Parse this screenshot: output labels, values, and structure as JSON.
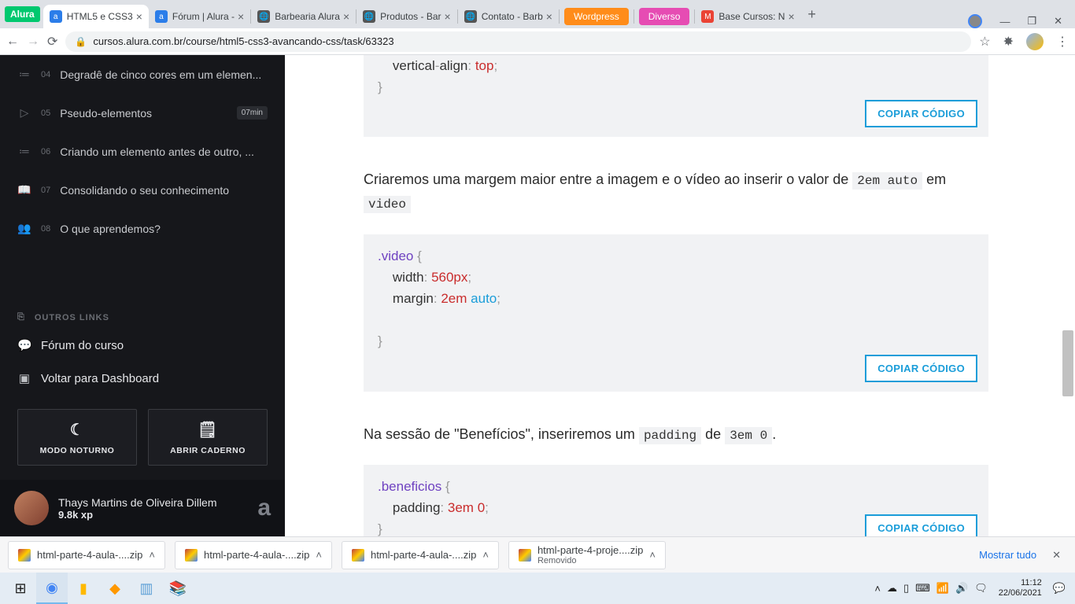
{
  "browser": {
    "product_badge": "Alura",
    "tabs": [
      {
        "title": "HTML5 e CSS3",
        "fav_bg": "#2b7de9",
        "fav_txt": "a",
        "active": true
      },
      {
        "title": "Fórum | Alura -",
        "fav_bg": "#2b7de9",
        "fav_txt": "a"
      },
      {
        "title": "Barbearia Alura",
        "fav_bg": "#555",
        "fav_txt": "🌐"
      },
      {
        "title": "Produtos - Bar",
        "fav_bg": "#555",
        "fav_txt": "🌐"
      },
      {
        "title": "Contato - Barb",
        "fav_bg": "#555",
        "fav_txt": "🌐"
      },
      {
        "title": "Wordpress",
        "fav_bg": "#ff8c1a",
        "fav_txt": "",
        "badge": true
      },
      {
        "title": "Diverso",
        "fav_bg": "#e64cb3",
        "fav_txt": "",
        "badge": true
      },
      {
        "title": "Base Cursos: N",
        "fav_bg": "#ea4335",
        "fav_txt": "M"
      }
    ],
    "url": "cursos.alura.com.br/course/html5-css3-avancando-css/task/63323"
  },
  "sidebar": {
    "items": [
      {
        "num": "04",
        "label": "Degradê de cinco cores em um elemen...",
        "ico": "≔"
      },
      {
        "num": "05",
        "label": "Pseudo-elementos",
        "ico": "▷",
        "dur": "07min"
      },
      {
        "num": "06",
        "label": "Criando um elemento antes de outro, ...",
        "ico": "≔"
      },
      {
        "num": "07",
        "label": "Consolidando o seu conhecimento",
        "ico": "📖"
      },
      {
        "num": "08",
        "label": "O que aprendemos?",
        "ico": "👥"
      }
    ],
    "section": "OUTROS LINKS",
    "links": [
      {
        "ico": "💬",
        "label": "Fórum do curso"
      },
      {
        "ico": "▣",
        "label": "Voltar para Dashboard"
      }
    ],
    "btn_night": "MODO NOTURNO",
    "btn_notes": "ABRIR CADERNO",
    "user": {
      "name": "Thays Martins de Oliveira Dillem",
      "xp": "9.8k xp",
      "brand": "a"
    }
  },
  "content": {
    "copy_btn": "COPIAR CÓDIGO",
    "code1_l1": "    vertical-align: top;",
    "code1_l2": "}",
    "para1_a": "Criaremos uma margem maior entre a imagem e o vídeo ao inserir o valor de ",
    "para1_code1": "2em auto",
    "para1_b": " em ",
    "para1_code2": "video",
    "code2": {
      "sel": ".video",
      "brace_o": " {",
      "prop1": "width",
      "val1": "560px",
      "prop2": "margin",
      "val2a": "2em",
      "val2b": "auto",
      "brace_c": "}"
    },
    "para2_a": "Na sessão de \"Benefícios\", inseriremos um ",
    "para2_code1": "padding",
    "para2_b": " de ",
    "para2_code2": "3em 0",
    "para2_c": ".",
    "code3": {
      "sel": ".beneficios",
      "brace_o": " {",
      "prop1": "padding",
      "val1a": "3em",
      "val1b": "0",
      "brace_c": "}"
    }
  },
  "downloads": {
    "items": [
      {
        "name": "html-parte-4-aula-....zip"
      },
      {
        "name": "html-parte-4-aula-....zip"
      },
      {
        "name": "html-parte-4-aula-....zip"
      },
      {
        "name": "html-parte-4-proje....zip",
        "sub": "Removido"
      }
    ],
    "show_all": "Mostrar tudo"
  },
  "taskbar": {
    "time": "11:12",
    "date": "22/06/2021"
  }
}
